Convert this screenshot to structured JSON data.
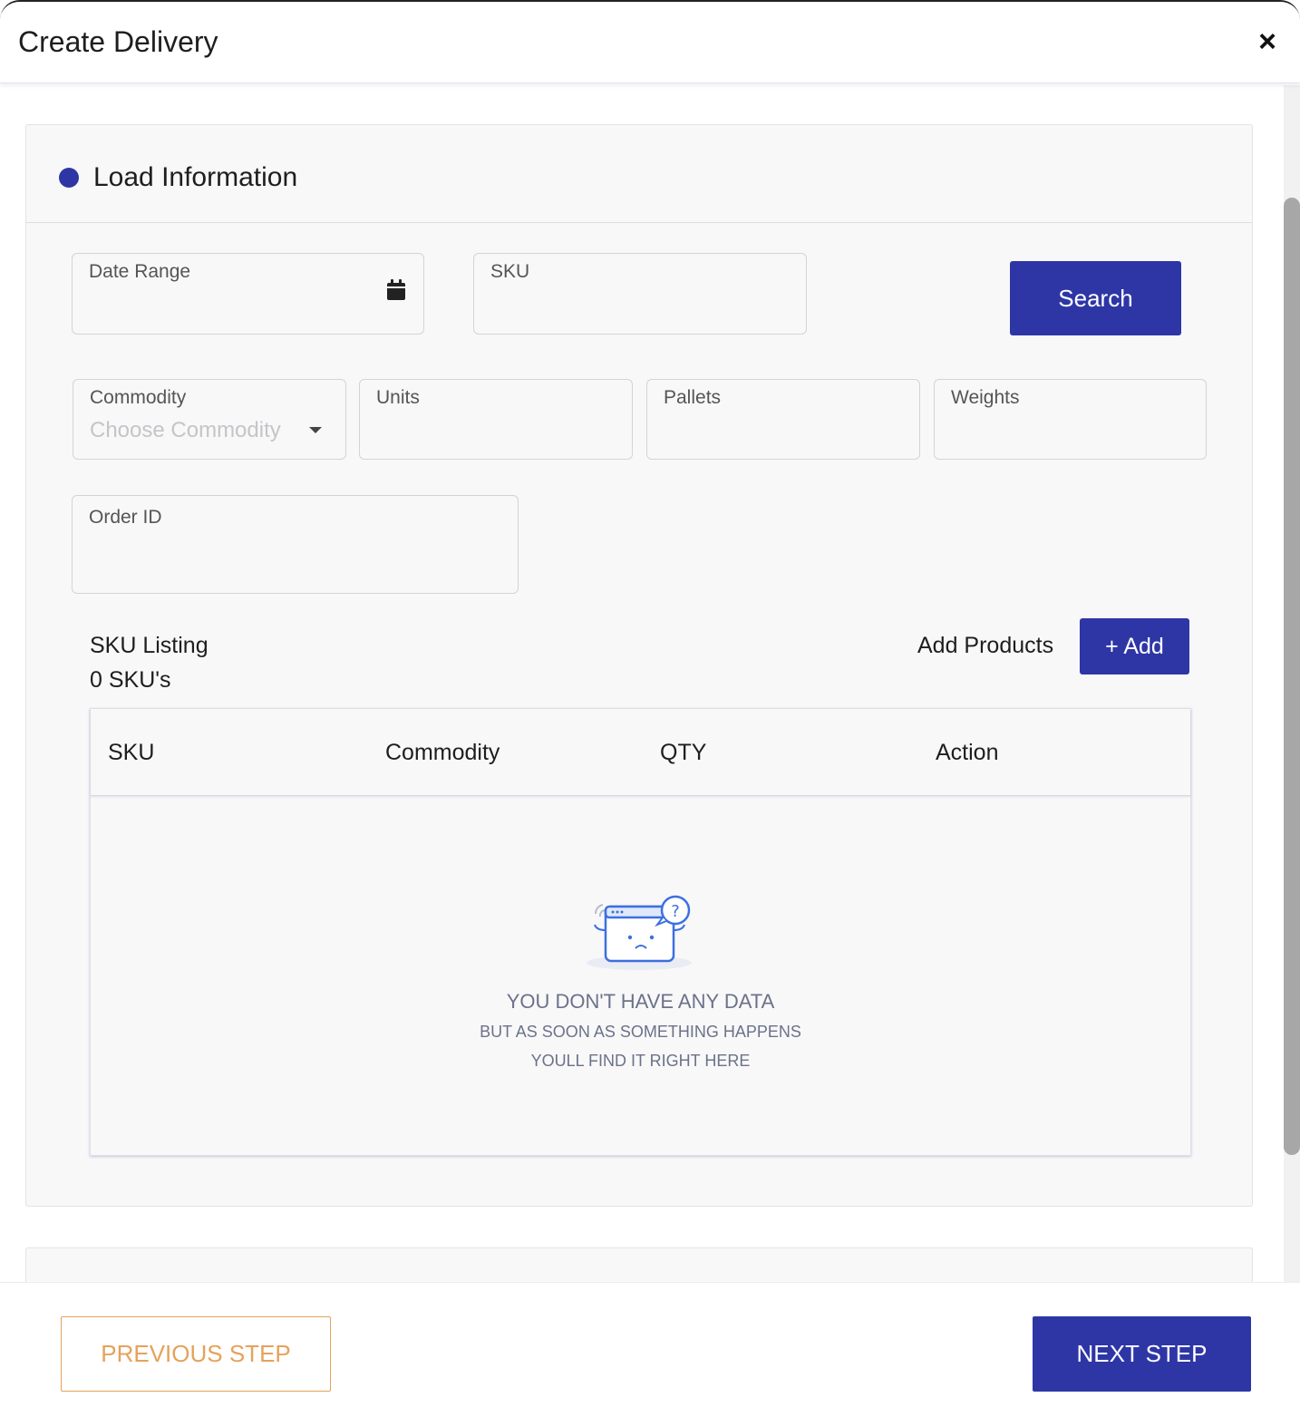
{
  "header": {
    "title": "Create Delivery",
    "close_symbol": "×"
  },
  "section": {
    "title": "Load Information"
  },
  "filters": {
    "date_range_label": "Date Range",
    "sku_label": "SKU",
    "search_label": "Search",
    "commodity_label": "Commodity",
    "commodity_placeholder": "Choose Commodity",
    "units_label": "Units",
    "pallets_label": "Pallets",
    "weights_label": "Weights",
    "order_id_label": "Order ID"
  },
  "listing": {
    "title": "SKU Listing",
    "count": "0 SKU's",
    "add_products_label": "Add Products",
    "add_button_label": "+ Add"
  },
  "table": {
    "columns": [
      "SKU",
      "Commodity",
      "QTY",
      "Action"
    ],
    "empty": {
      "title": "YOU DON'T HAVE ANY DATA",
      "line1": "BUT AS SOON AS SOMETHING HAPPENS",
      "line2": "YOULL FIND IT RIGHT HERE",
      "icon": "empty-box-question-icon"
    }
  },
  "footer": {
    "previous_label": "PREVIOUS STEP",
    "next_label": "NEXT STEP"
  },
  "colors": {
    "primary": "#2e36a6",
    "secondary_outline": "#e5a25b",
    "empty_text": "#6b7289"
  }
}
